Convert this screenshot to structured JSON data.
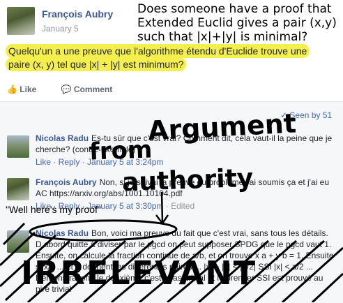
{
  "post": {
    "author": "François Aubry",
    "date": "January 5",
    "text": "Quelqu'un a une preuve que l'algorithme étendu d'Euclide trouve une paire (x, y) tel que |x| + |y| est minimum?",
    "like_label": "Like",
    "comment_label": "Comment"
  },
  "seen_by": "Seen by 51",
  "comments": [
    {
      "author": "Nicolas Radu",
      "text": "Es-tu sûr que c'est vrai? Comment dit, cela vaut-il la peine que je cherche? (contre-exemple)",
      "meta": "Like · Reply · January 5 at 3:24pm"
    },
    {
      "author": "François Aubry",
      "text": "Non, si je suivai la preuve du problème j'ai soumis ça et j'ai eu AC https://arxiv.org/abs/1001.10104.pdf",
      "link": "1001/10104.pdf",
      "meta": "Like · Reply · January 5 at 3:30pm",
      "edited": "· Edited"
    },
    {
      "author": "Nicolas Radu",
      "text": "Bon, voici ma preuve du fait que c'est vrai, sans tous les détails. D abord quitte à diviser par le pgcd on peut supposer SPDG que le pgcd vaut 1. Ensuite, on calcule la fraction continue de a/b, et on trouve x a + y b = 1. Ensuite si x/y ... et b donnent les différentes paires ... |x| + |y| < |a/2| SSI |x| < a/2 ... Démonstration : le deuxième c'est quasi trivial et le premier SSI est prouvé au pire trivial",
      "meta": ""
    }
  ],
  "overlay": {
    "question": "Does someone have a proof that Extended Euclid gives a pair (x,y) such that |x|+|y| is minimal?",
    "argument": "Argument",
    "from": "from",
    "authority": "authority",
    "caption": "\"Well here's my proof\"",
    "irrelevant": "IRRELEVANT"
  }
}
